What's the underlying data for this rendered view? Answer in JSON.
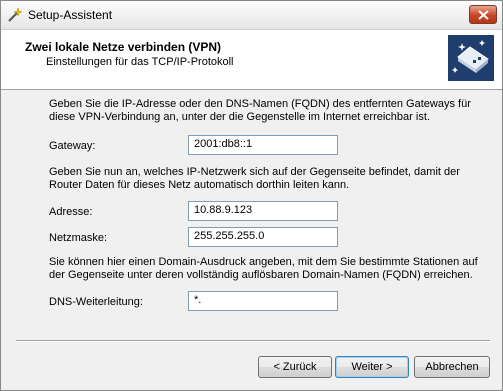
{
  "window": {
    "title": "Setup-Assistent"
  },
  "header": {
    "title": "Zwei lokale Netze verbinden (VPN)",
    "subtitle": "Einstellungen für das TCP/IP-Protokoll"
  },
  "section1": {
    "text_line1": "Geben Sie die IP-Adresse oder den DNS-Namen (FQDN) des entfernten Gateways für",
    "text_line2": "diese VPN-Verbindung an, unter der die Gegenstelle im Internet erreichbar ist.",
    "gateway_label": "Gateway:",
    "gateway_value": "2001:db8::1"
  },
  "section2": {
    "text_line1": "Geben Sie nun an, welches IP-Netzwerk sich auf der Gegenseite befindet, damit der",
    "text_line2": "Router Daten für dieses Netz automatisch dorthin leiten kann.",
    "address_label": "Adresse:",
    "address_value": "10.88.9.123",
    "netmask_label": "Netzmaske:",
    "netmask_value": "255.255.255.0"
  },
  "section3": {
    "text_line1": "Sie können hier einen Domain-Ausdruck angeben, mit dem Sie bestimmte Stationen auf",
    "text_line2": "der Gegenseite unter deren vollständig auflösbaren Domain-Namen (FQDN) erreichen.",
    "dns_label": "DNS-Weiterleitung:",
    "dns_value": "*."
  },
  "buttons": {
    "back": "< Zurück",
    "next": "Weiter >",
    "cancel": "Abbrechen"
  },
  "icons": {
    "title": "wizard-wand-icon",
    "close": "close-icon",
    "logo": "network-wizard-logo-icon"
  }
}
